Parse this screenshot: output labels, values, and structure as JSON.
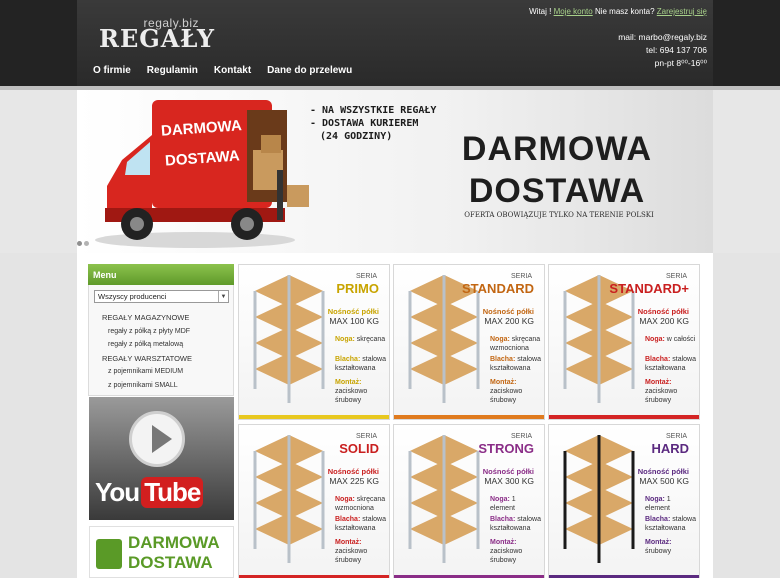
{
  "header": {
    "logo_top": "regaly.biz",
    "logo_main": "REGAŁY",
    "welcome_prefix": "Witaj ! ",
    "my_account": "Moje konto",
    "no_account": " Nie masz konta? ",
    "register": "Zarejestruj się",
    "mail": "mail: marbo@regaly.biz",
    "phone": "tel: 694 137 706",
    "hours": "pn-pt 8⁰⁰-16⁰⁰"
  },
  "nav": [
    "O firmie",
    "Regulamin",
    "Kontakt",
    "Dane do przelewu"
  ],
  "banner": {
    "truck_text_1": "DARMOWA",
    "truck_text_2": "DOSTAWA",
    "bullets": [
      "- NA WSZYSTKIE REGAŁY",
      "- DOSTAWA KURIEREM",
      "(24 GODZINY)"
    ],
    "headline_1": "DARMOWA",
    "headline_2": "DOSTAWA",
    "note": "OFERTA OBOWIĄZUJE TYLKO NA TERENIE POLSKI"
  },
  "sidebar": {
    "menu_title": "Menu",
    "producer_select": "Wszyscy producenci",
    "categories": [
      {
        "label": "REGAŁY MAGAZYNOWE",
        "level": "cat"
      },
      {
        "label": "regały z półką z płyty MDF",
        "level": "sub"
      },
      {
        "label": "regały z półką metalową",
        "level": "sub"
      },
      {
        "label": "REGAŁY WARSZTATOWE",
        "level": "cat"
      },
      {
        "label": "z pojemnikami MEDIUM",
        "level": "sub"
      },
      {
        "label": "z pojemnikami SMALL",
        "level": "sub"
      }
    ],
    "youtube_you": "You",
    "youtube_tube": "Tube",
    "free_1": "DARMOWA",
    "free_2": "DOSTAWA"
  },
  "colors": {
    "accent_green": "#6aa532",
    "primo": "#e8c81f",
    "standard": "#e07b1e",
    "standard_plus": "#d42424",
    "solid": "#d42424",
    "strong": "#8a2d87",
    "hard": "#5b2a80"
  },
  "products": [
    {
      "seria": "SERIA",
      "name": "PRIMO",
      "color": "#c8a400",
      "bar": "#e8c81f",
      "load_label": "Nośność półki",
      "load": "MAX 100 KG",
      "specs": [
        [
          "Noga:",
          "skręcana"
        ],
        [
          "Blacha:",
          "stalowa kształtowana"
        ],
        [
          "Montaż:",
          "zaciskowo śrubowy"
        ]
      ]
    },
    {
      "seria": "SERIA",
      "name": "STANDARD",
      "color": "#c26612",
      "bar": "#e07b1e",
      "load_label": "Nośność półki",
      "load": "MAX 200 KG",
      "specs": [
        [
          "Noga:",
          "skręcana wzmocniona"
        ],
        [
          "Blacha:",
          "stalowa kształtowana"
        ],
        [
          "Montaż:",
          "zaciskowo śrubowy"
        ]
      ]
    },
    {
      "seria": "SERIA",
      "name": "STANDARD+",
      "color": "#c91f1f",
      "bar": "#d42424",
      "load_label": "Nośność półki",
      "load": "MAX 200 KG",
      "specs": [
        [
          "Noga:",
          "w całości"
        ],
        [
          "Blacha:",
          "stalowa kształtowana"
        ],
        [
          "Montaż:",
          "zaciskowo śrubowy"
        ]
      ]
    },
    {
      "seria": "SERIA",
      "name": "SOLID",
      "color": "#c91f1f",
      "bar": "#d42424",
      "load_label": "Nośność półki",
      "load": "MAX 225 KG",
      "specs": [
        [
          "Noga:",
          "skręcana wzmocniona"
        ],
        [
          "Blacha:",
          "stalowa kształtowana"
        ],
        [
          "Montaż:",
          "zaciskowo śrubowy"
        ]
      ]
    },
    {
      "seria": "SERIA",
      "name": "STRONG",
      "color": "#8a2d87",
      "bar": "#8a2d87",
      "load_label": "Nośność półki",
      "load": "MAX 300 KG",
      "specs": [
        [
          "Noga:",
          "1 element"
        ],
        [
          "Blacha:",
          "stalowa kształtowana"
        ],
        [
          "Montaż:",
          "zaciskowo śrubowy"
        ]
      ]
    },
    {
      "seria": "SERIA",
      "name": "HARD",
      "color": "#5b2a80",
      "bar": "#5b2a80",
      "load_label": "Nośność półki",
      "load": "MAX 500 KG",
      "specs": [
        [
          "Noga:",
          "1 element"
        ],
        [
          "Blacha:",
          "stalowa kształtowana"
        ],
        [
          "Montaż:",
          "śrubowy"
        ]
      ]
    }
  ]
}
